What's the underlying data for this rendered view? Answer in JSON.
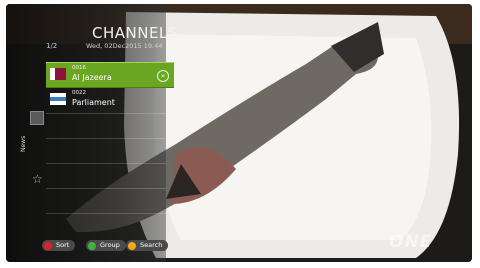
{
  "header": {
    "title": "CHANNELS",
    "page": "1/2",
    "datetime": "Wed, 02Dec2015 19:44"
  },
  "channels": [
    {
      "number": "0016",
      "name": "Al Jazeera",
      "selected": true
    },
    {
      "number": "0022",
      "name": "Parliament",
      "selected": false
    }
  ],
  "side": {
    "label": "News",
    "box_icon": "square-icon",
    "star_icon": "star-icon"
  },
  "buttons": [
    {
      "label": "Sort",
      "color": "#e0202a"
    },
    {
      "label": "Group",
      "color": "#3fb23f"
    },
    {
      "label": "Search",
      "color": "#f2a917"
    }
  ],
  "watermark": "ONE",
  "colors": {
    "selection": "#6aa622",
    "overlay": "#141414"
  }
}
